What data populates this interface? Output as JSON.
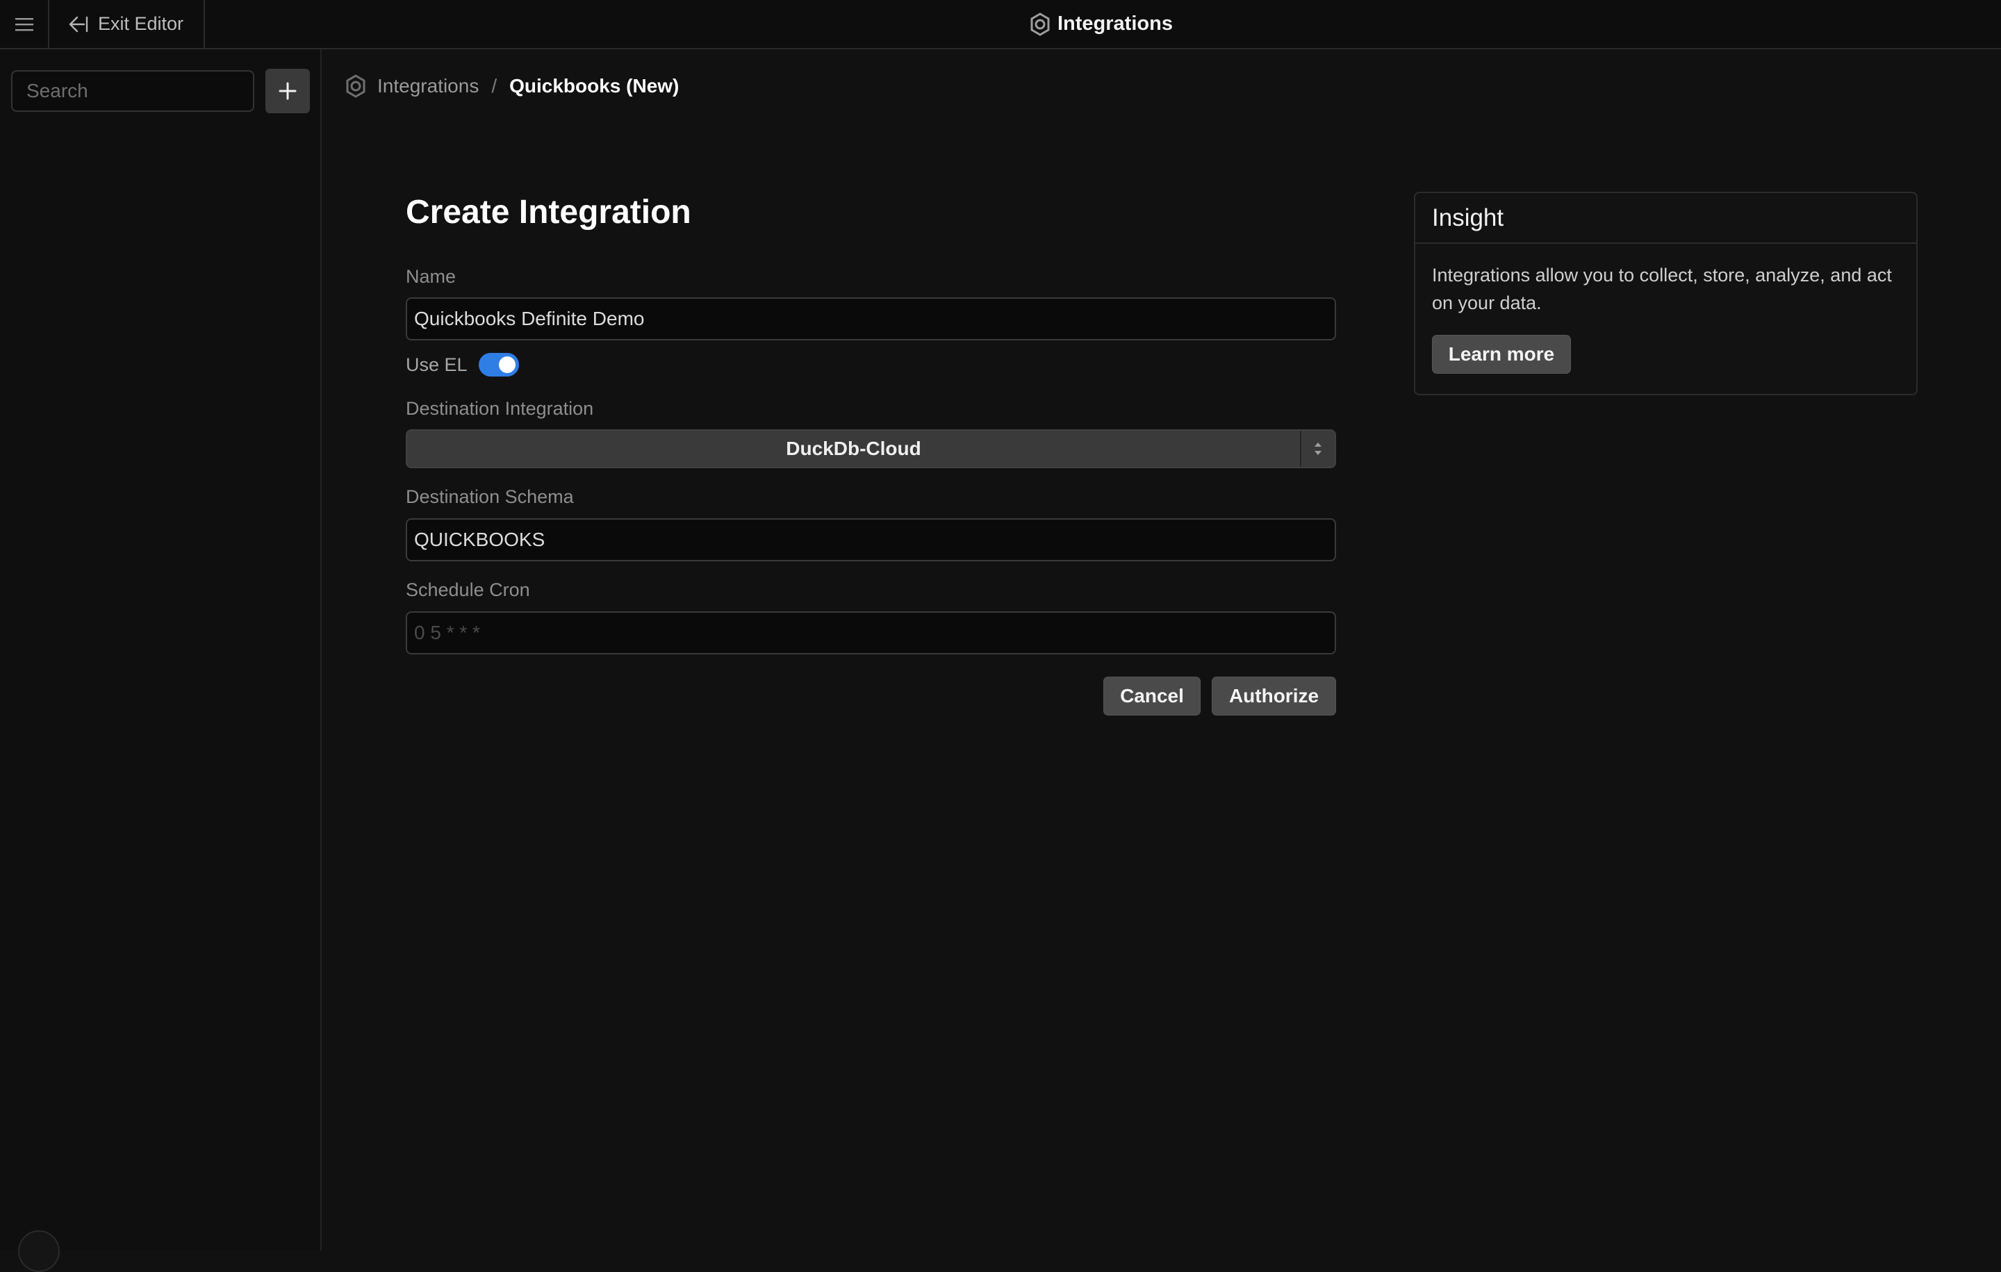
{
  "header": {
    "menu_icon": "hamburger-menu-icon",
    "exit_icon": "exit-arrow-icon",
    "exit_label": "Exit Editor",
    "app_icon": "integrations-icon",
    "app_title": "Integrations"
  },
  "sidebar": {
    "search_placeholder": "Search",
    "search_value": "",
    "add_icon": "plus-icon"
  },
  "breadcrumb": {
    "icon": "integrations-icon",
    "root": "Integrations",
    "separator": "/",
    "current": "Quickbooks (New)"
  },
  "form": {
    "title": "Create Integration",
    "name_label": "Name",
    "name_value": "Quickbooks Definite Demo",
    "use_el_label": "Use EL",
    "use_el_enabled": true,
    "destination_label": "Destination Integration",
    "destination_value": "DuckDb-Cloud",
    "schema_label": "Destination Schema",
    "schema_value": "QUICKBOOKS",
    "cron_label": "Schedule Cron",
    "cron_value": "",
    "cron_placeholder": "0 5 * * *",
    "cancel_label": "Cancel",
    "authorize_label": "Authorize"
  },
  "insight": {
    "title": "Insight",
    "body": "Integrations allow you to collect, store, analyze, and act on your data.",
    "learn_more_label": "Learn more"
  },
  "colors": {
    "background": "#111111",
    "toggle_on": "#2f7ee6",
    "button": "#4a4a4a"
  }
}
